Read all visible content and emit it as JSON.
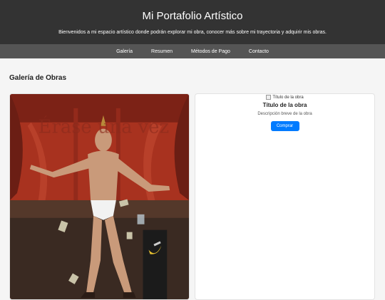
{
  "header": {
    "title": "Mi Portafolio Artístico",
    "tagline": "Bienvenidos a mi espacio artístico donde podrán explorar mi obra, conocer más sobre mi trayectoria y adquirir mis obras."
  },
  "nav": {
    "items": [
      "Galería",
      "Resumen",
      "Métodos de Pago",
      "Contacto"
    ]
  },
  "gallery": {
    "heading": "Galería de Obras",
    "cards": [
      {
        "image_alt": "Título de la obra",
        "title": "Título de la obra",
        "description": "Descripción breve de la obra",
        "button_label": "Comprar"
      }
    ]
  },
  "colors": {
    "header_bg": "#333333",
    "nav_bg": "#555555",
    "button_bg": "#007bff",
    "page_bg": "#f5f5f5"
  }
}
